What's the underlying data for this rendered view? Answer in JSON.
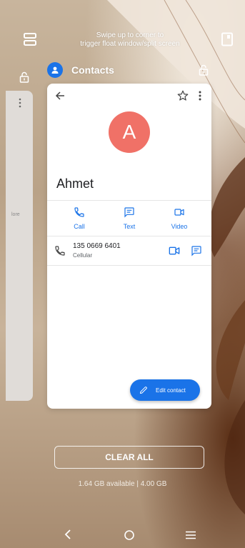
{
  "top_hint": {
    "line1": "Swipe up to corner to",
    "line2": "trigger float window/split screen"
  },
  "icons": {
    "split_screen": "split-screen-icon",
    "float_window": "float-window-icon",
    "lock": "lock-icon"
  },
  "background_card": {
    "partial_text": "lore"
  },
  "app": {
    "name": "Contacts",
    "icon": "contacts-person-icon"
  },
  "contact": {
    "avatar_letter": "A",
    "avatar_color": "#f07167",
    "name": "Ahmet",
    "actions": [
      {
        "label": "Call",
        "icon": "phone-icon"
      },
      {
        "label": "Text",
        "icon": "message-icon"
      },
      {
        "label": "Video",
        "icon": "videocam-icon"
      }
    ],
    "phone": {
      "number": "135 0669 6401",
      "type": "Cellular"
    },
    "edit_button": "Edit contact"
  },
  "recents": {
    "clear_all": "CLEAR ALL",
    "memory": "1.64 GB available | 4.00 GB"
  },
  "colors": {
    "accent": "#1a73e8"
  }
}
